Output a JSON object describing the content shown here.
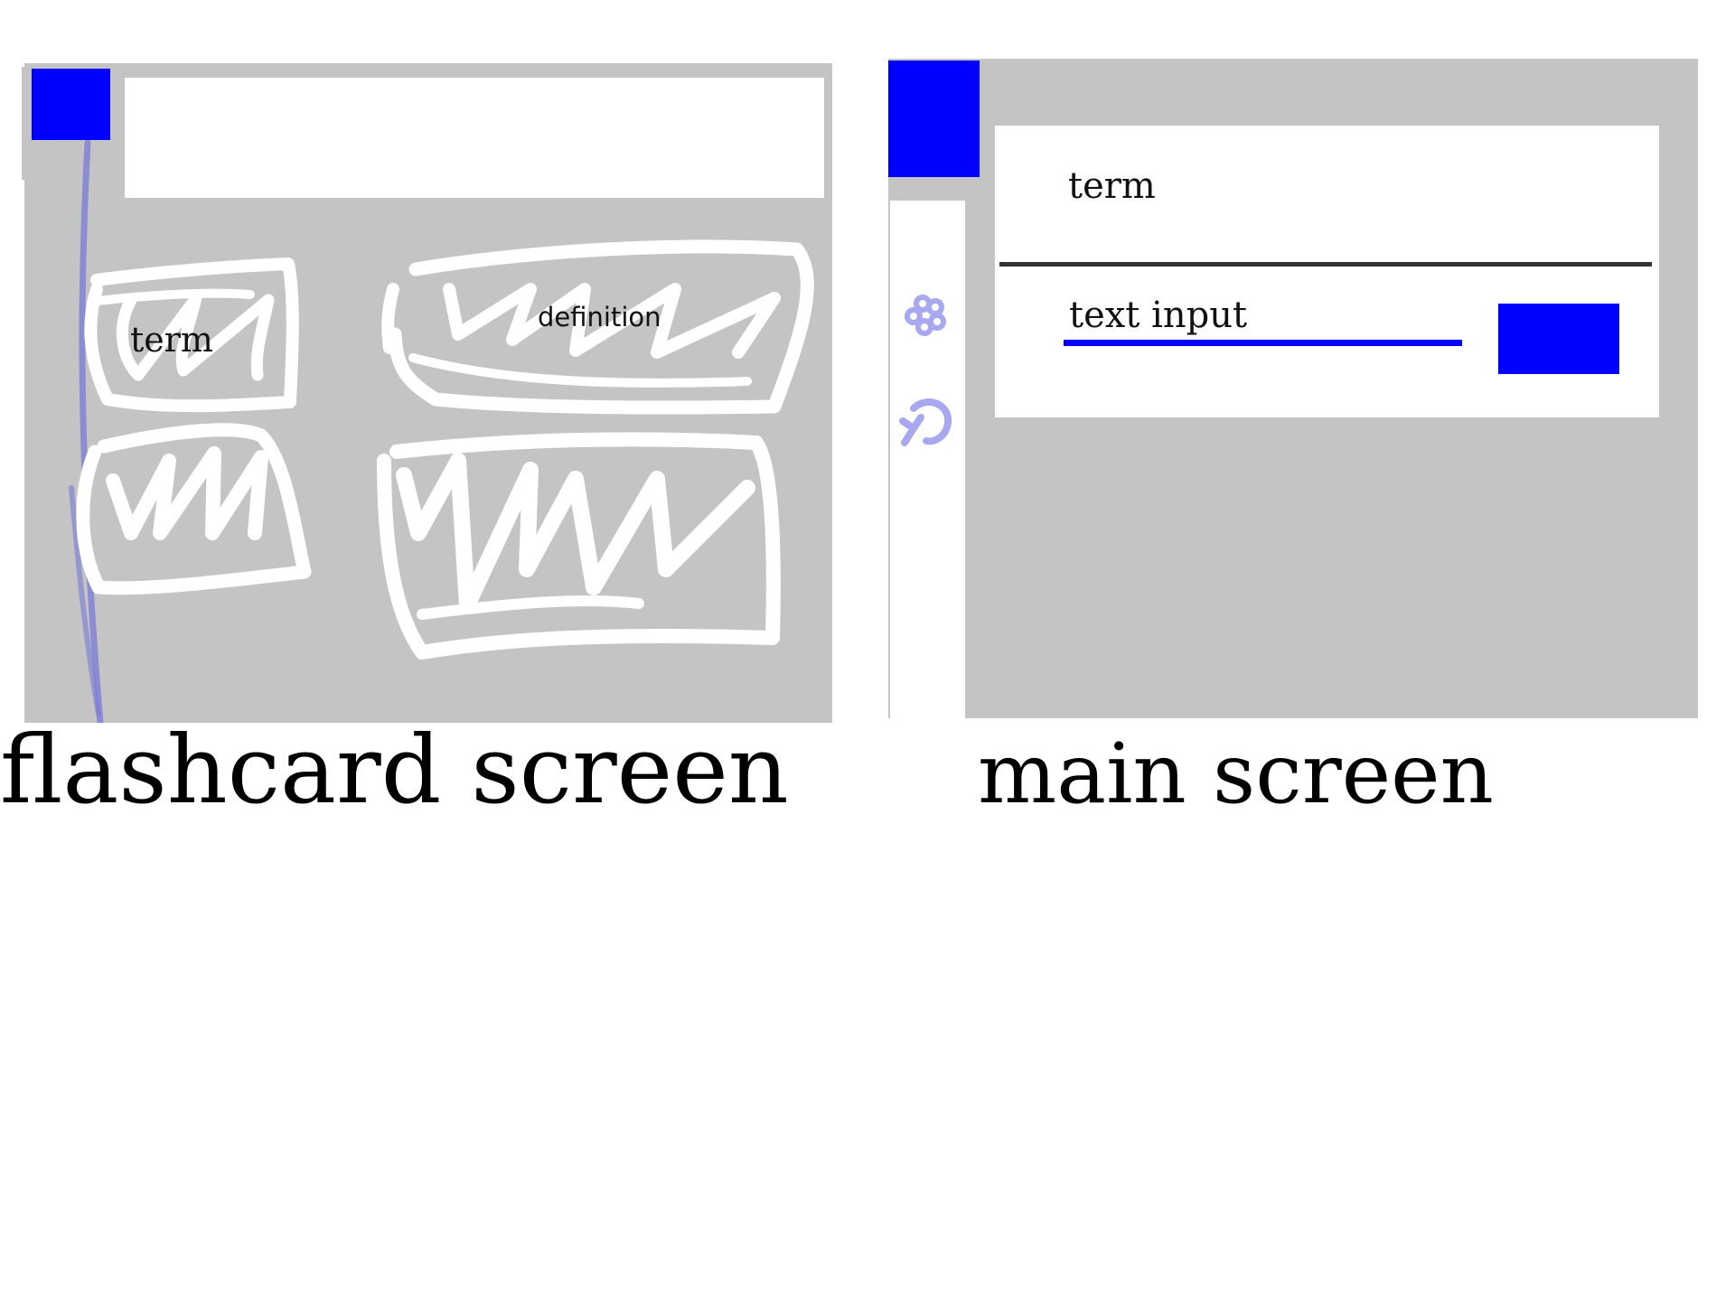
{
  "flashcard_screen": {
    "card_labels": {
      "term": "term",
      "definition": "definition"
    },
    "caption": "flashcard screen",
    "colors": {
      "background": "#c4c4c4",
      "accent": "#0000ff",
      "card_scribble": "#ffffff",
      "sketch_stroke": "#8888dd"
    }
  },
  "main_screen": {
    "term_label": "term",
    "text_input": {
      "placeholder": "text input",
      "value": ""
    },
    "sidebar_icons": [
      "flower-icon",
      "undo-icon"
    ],
    "caption": "main screen",
    "colors": {
      "background": "#c4c4c4",
      "accent": "#0000ff",
      "divider": "#333333",
      "icon": "#9999ee"
    }
  }
}
